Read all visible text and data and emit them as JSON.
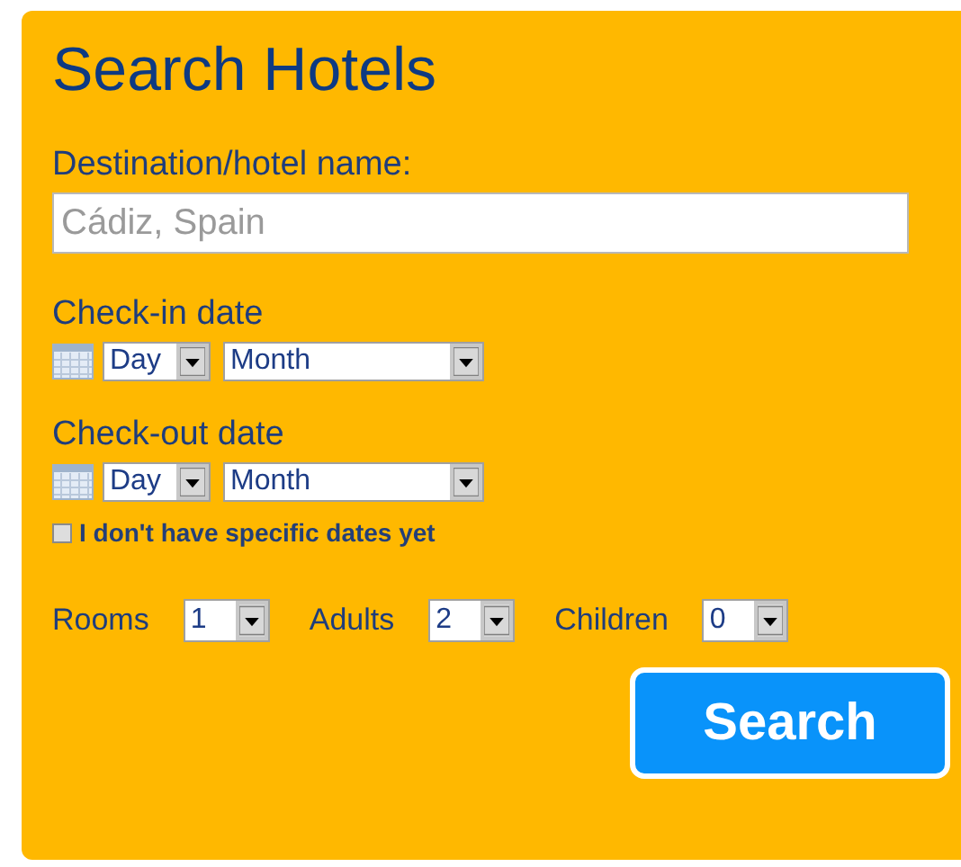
{
  "title": "Search Hotels",
  "destination": {
    "label": "Destination/hotel name:",
    "placeholder": "Cádiz, Spain"
  },
  "dates": [
    {
      "label": "Check-in date",
      "day": "Day",
      "month": "Month"
    },
    {
      "label": "Check-out date",
      "day": "Day",
      "month": "Month"
    }
  ],
  "no_dates": {
    "label": "I don't have specific dates yet",
    "checked": false
  },
  "guests": [
    {
      "label": "Rooms",
      "value": "1"
    },
    {
      "label": "Adults",
      "value": "2"
    },
    {
      "label": "Children",
      "value": "0"
    }
  ],
  "search_button": "Search"
}
